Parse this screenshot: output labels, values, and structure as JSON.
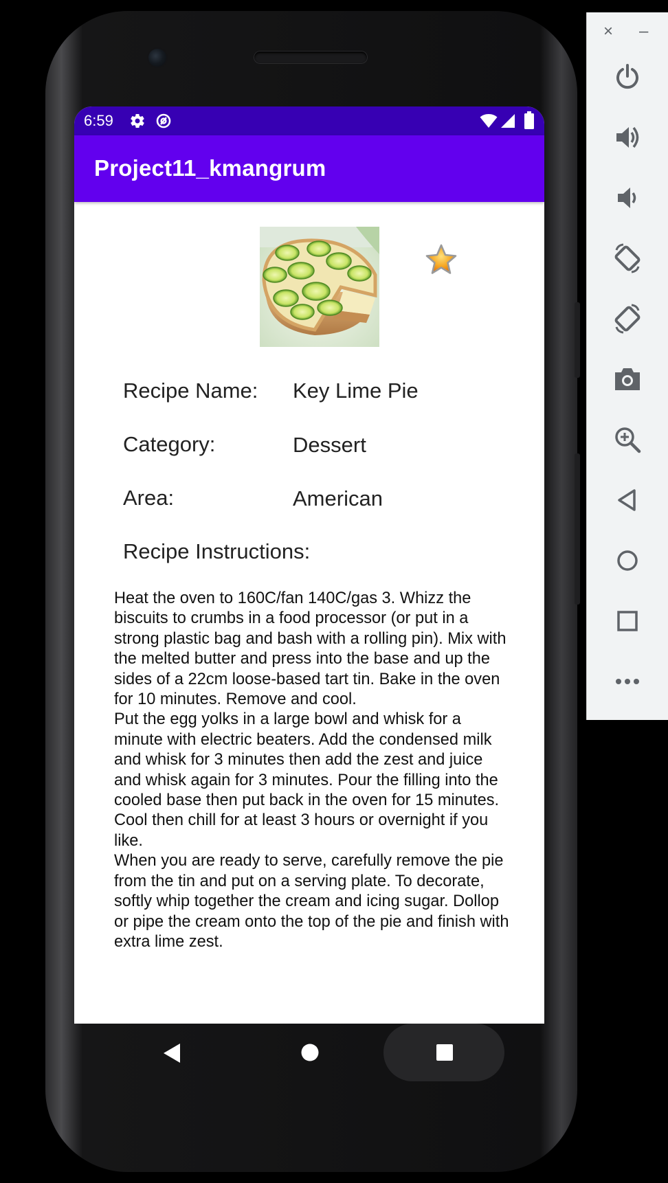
{
  "status_bar": {
    "time": "6:59",
    "icons": [
      "gear-icon",
      "at-sign-icon",
      "wifi-icon",
      "signal-icon",
      "battery-icon"
    ]
  },
  "app_bar": {
    "title": "Project11_kmangrum",
    "color": "#6200EE",
    "status_color": "#3700B3"
  },
  "recipe": {
    "image_alt": "key-lime-pie-photo",
    "favorite_icon": "star-icon",
    "fields": [
      {
        "label": "Recipe Name:",
        "value": "Key Lime Pie"
      },
      {
        "label": "Category:",
        "value": "Dessert"
      },
      {
        "label": "Area:",
        "value": "American"
      }
    ],
    "instructions_label": "Recipe Instructions:",
    "instructions": "Heat the oven to 160C/fan 140C/gas 3. Whizz the biscuits to crumbs in a food processor (or put in a strong plastic bag and bash with a rolling pin). Mix with the melted butter and press into the base and up the sides of a 22cm loose-based tart tin. Bake in the oven for 10 minutes. Remove and cool.\nPut the egg yolks in a large bowl and whisk for a minute with electric beaters. Add the condensed milk and whisk for 3 minutes then add the zest and juice and whisk again for 3 minutes. Pour the filling into the cooled base then put back in the oven for 15 minutes. Cool then chill for at least 3 hours or overnight if you like.\nWhen you are ready to serve, carefully remove the pie from the tin and put on a serving plate. To decorate, softly whip together the cream and icing sugar. Dollop or pipe the cream onto the top of the pie and finish with extra lime zest."
  },
  "nav_bar": {
    "buttons": [
      "back-icon",
      "home-icon",
      "recents-icon"
    ]
  },
  "emulator_panel": {
    "window_controls": {
      "close": "×",
      "minimize": "–"
    },
    "buttons": [
      "power-icon",
      "volume-up-icon",
      "volume-down-icon",
      "rotate-left-icon",
      "rotate-right-icon",
      "camera-icon",
      "zoom-icon",
      "back-icon",
      "home-icon",
      "overview-icon",
      "more-icon"
    ]
  }
}
